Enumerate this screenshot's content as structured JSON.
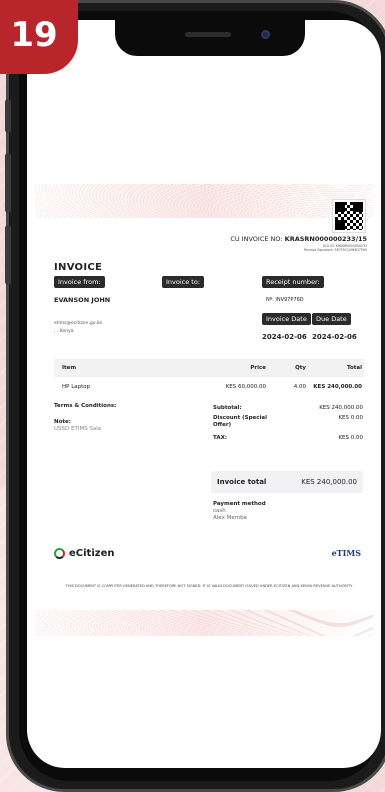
{
  "badge": {
    "number": "19"
  },
  "invoice": {
    "cu_label": "CU INVOICE NO:",
    "cu_number": "KRASRN000000233/15",
    "scu_line": "SCU ID: KRASRN000000233",
    "sig_line": "Receipt Signature: 3B7F5C1VW9D7F6H",
    "title": "INVOICE",
    "invoice_from_label": "Invoice from:",
    "invoice_to_label": "Invoice to:",
    "receipt_number_label": "Receipt number:",
    "from_name": "EVANSON JOHN",
    "from_email": "etims@ecitizen.go.ke",
    "from_location": ", , Kenya",
    "receipt_number": "Nº: INV97P76D",
    "invoice_date_label": "Invoice Date",
    "due_date_label": "Due Date",
    "invoice_date": "2024-02-06",
    "due_date": "2024-02-06",
    "table": {
      "headers": [
        "Item",
        "Price",
        "Qty",
        "Total"
      ],
      "rows": [
        {
          "item": "HP Laptop",
          "price": "KES 60,000.00",
          "qty": "4.00",
          "total": "KES 240,000.00"
        }
      ]
    },
    "terms_label": "Terms & Conditions:",
    "note_label": "Note:",
    "note_value": "USSD ETIMS Sale",
    "subtotal_label": "Subtotal:",
    "subtotal_value": "KES 240,000.00",
    "discount_label": "Discount (Special Offer)",
    "discount_value": "KES 0.00",
    "tax_label": "TAX:",
    "tax_value": "KES 0.00",
    "invoice_total_label": "Invoice total",
    "invoice_total_value": "KES 240,000.00",
    "payment_method_label": "Payment method",
    "payment_method_value": "cash",
    "payer_name": "Alex Memba",
    "ecitizen_logo_text": "eCitizen",
    "etims_logo_text": "eTIMS",
    "disclaimer": "THIS DOCUMENT IS COMPUTER GENERATED AND THEREFORE NOT SIGNED. IT IS VALID DOCUMENT ISSUED UNDER ECITIZEN AND KENYA REVENUE AUTHORITY"
  }
}
